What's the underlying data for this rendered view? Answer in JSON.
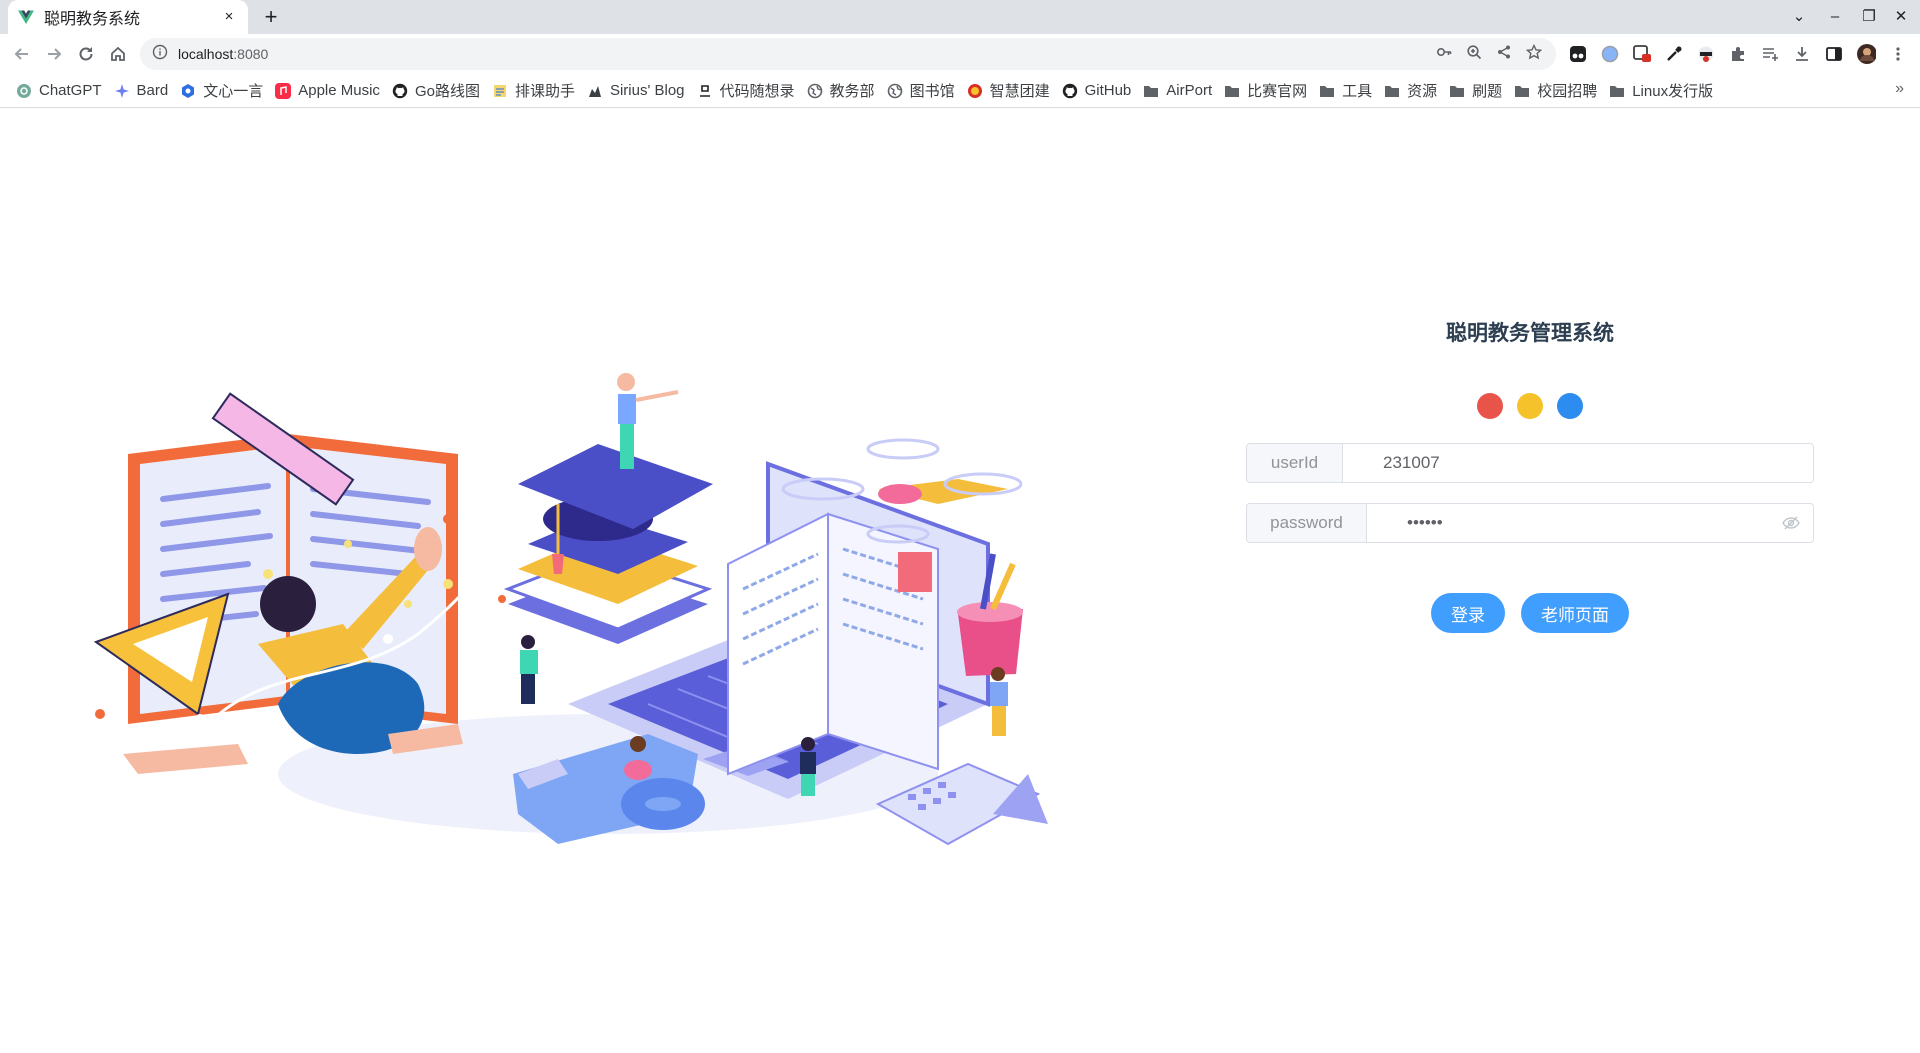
{
  "browser": {
    "tab": {
      "title": "聪明教务系统",
      "close": "×"
    },
    "new_tab": "+",
    "address": {
      "host": "localhost",
      "port": ":8080"
    },
    "window_controls": {
      "dropdown": "⌄",
      "minimize": "–",
      "restore": "❐",
      "close": "✕"
    },
    "bookmarks": [
      {
        "label": "ChatGPT",
        "icon": "chatgpt-icon"
      },
      {
        "label": "Bard",
        "icon": "bard-icon"
      },
      {
        "label": "文心一言",
        "icon": "ernie-icon"
      },
      {
        "label": "Apple Music",
        "icon": "apple-music-icon"
      },
      {
        "label": "Go路线图",
        "icon": "github-icon"
      },
      {
        "label": "排课助手",
        "icon": "schedule-icon"
      },
      {
        "label": "Sirius' Blog",
        "icon": "blog-icon"
      },
      {
        "label": "代码随想录",
        "icon": "code-icon"
      },
      {
        "label": "教务部",
        "icon": "globe-icon"
      },
      {
        "label": "图书馆",
        "icon": "globe-icon"
      },
      {
        "label": "智慧团建",
        "icon": "league-icon"
      },
      {
        "label": "GitHub",
        "icon": "github-icon"
      },
      {
        "label": "AirPort",
        "icon": "folder-icon"
      },
      {
        "label": "比赛官网",
        "icon": "folder-icon"
      },
      {
        "label": "工具",
        "icon": "folder-icon"
      },
      {
        "label": "资源",
        "icon": "folder-icon"
      },
      {
        "label": "刷题",
        "icon": "folder-icon"
      },
      {
        "label": "校园招聘",
        "icon": "folder-icon"
      },
      {
        "label": "Linux发行版",
        "icon": "folder-icon"
      }
    ],
    "bookmarks_more": "»"
  },
  "login": {
    "title": "聪明教务管理系统",
    "dot_colors": [
      "#e8534a",
      "#f5c22b",
      "#2d8cf0"
    ],
    "userid_label": "userId",
    "userid_value": "231007",
    "password_label": "password",
    "password_value": "••••••",
    "login_button": "登录",
    "teacher_button": "老师页面"
  },
  "colors": {
    "accent": "#409eff",
    "title": "#2c3e50"
  }
}
